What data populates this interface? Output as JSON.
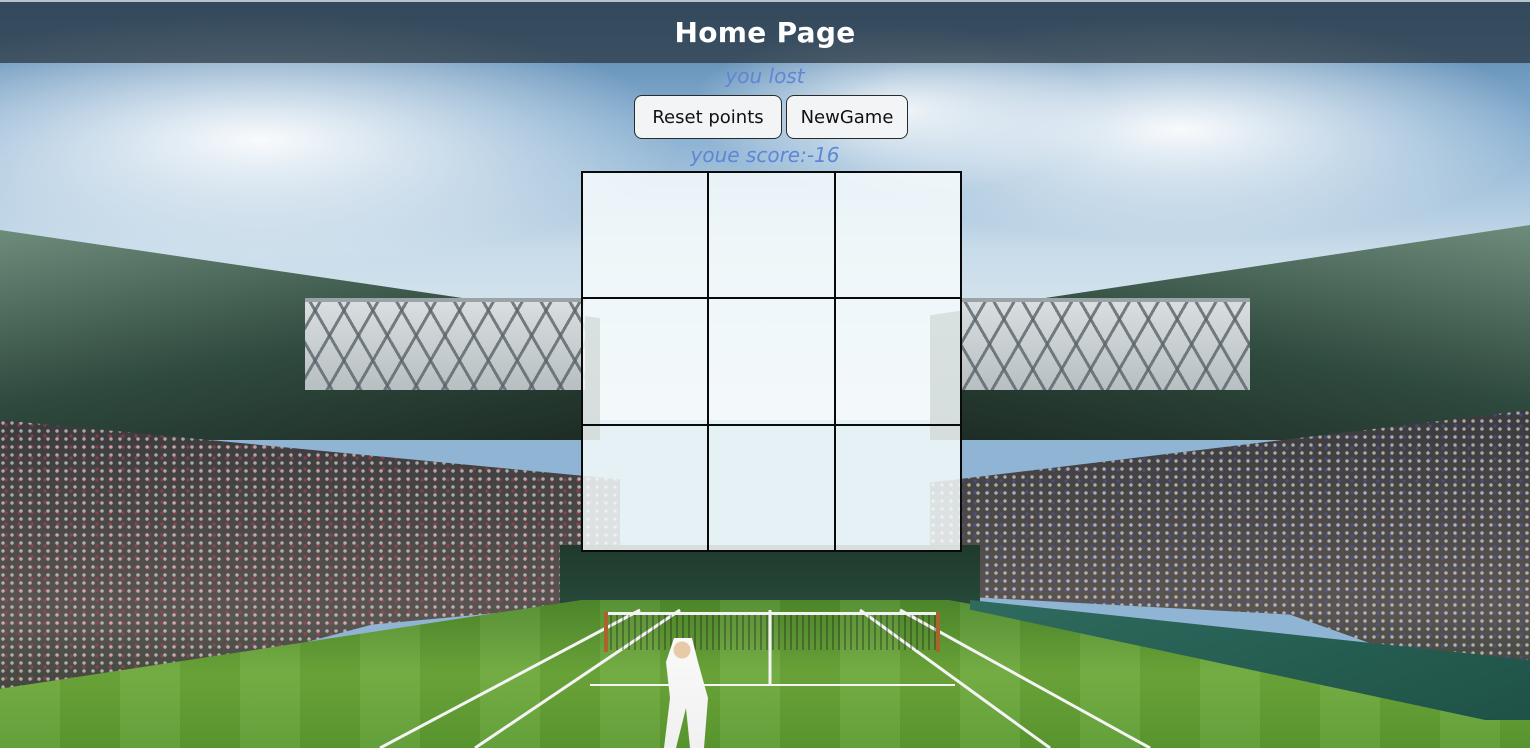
{
  "header": {
    "title": "Home Page"
  },
  "game": {
    "status_text": "you lost",
    "score_text": "youe score:-16",
    "reset_label": "Reset points",
    "newgame_label": "NewGame",
    "cells": [
      "",
      "",
      "",
      "",
      "",
      "",
      "",
      "",
      ""
    ]
  },
  "colors": {
    "header_bg": "#28343e",
    "status_text": "#5f86d6",
    "button_bg": "#f3f4f5",
    "grid_line": "#0a0a0a"
  }
}
